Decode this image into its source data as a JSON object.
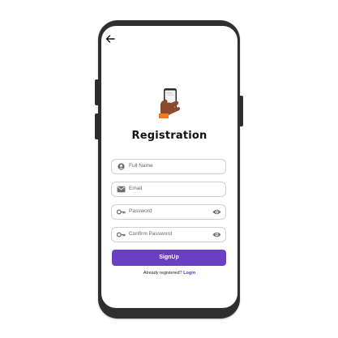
{
  "screen": {
    "title": "Registration",
    "back_icon": "arrow-left-icon",
    "illustration_icon": "hand-holding-phone-illustration"
  },
  "form": {
    "full_name": {
      "placeholder": "Full Name",
      "icon": "person-circle-icon"
    },
    "email": {
      "placeholder": "Email",
      "icon": "envelope-icon"
    },
    "password": {
      "placeholder": "Password",
      "icon": "key-icon",
      "toggle_icon": "eye-icon"
    },
    "confirm_password": {
      "placeholder": "Confirm Password",
      "icon": "key-icon",
      "toggle_icon": "eye-icon"
    }
  },
  "actions": {
    "signup_label": "SignUp",
    "footer_text": "Already registered?",
    "login_label": "Login"
  },
  "colors": {
    "accent": "#6a3fc1",
    "login_link": "#5a35b5",
    "phone_frame": "#2f2f2f",
    "field_border": "#cfcfcf"
  }
}
